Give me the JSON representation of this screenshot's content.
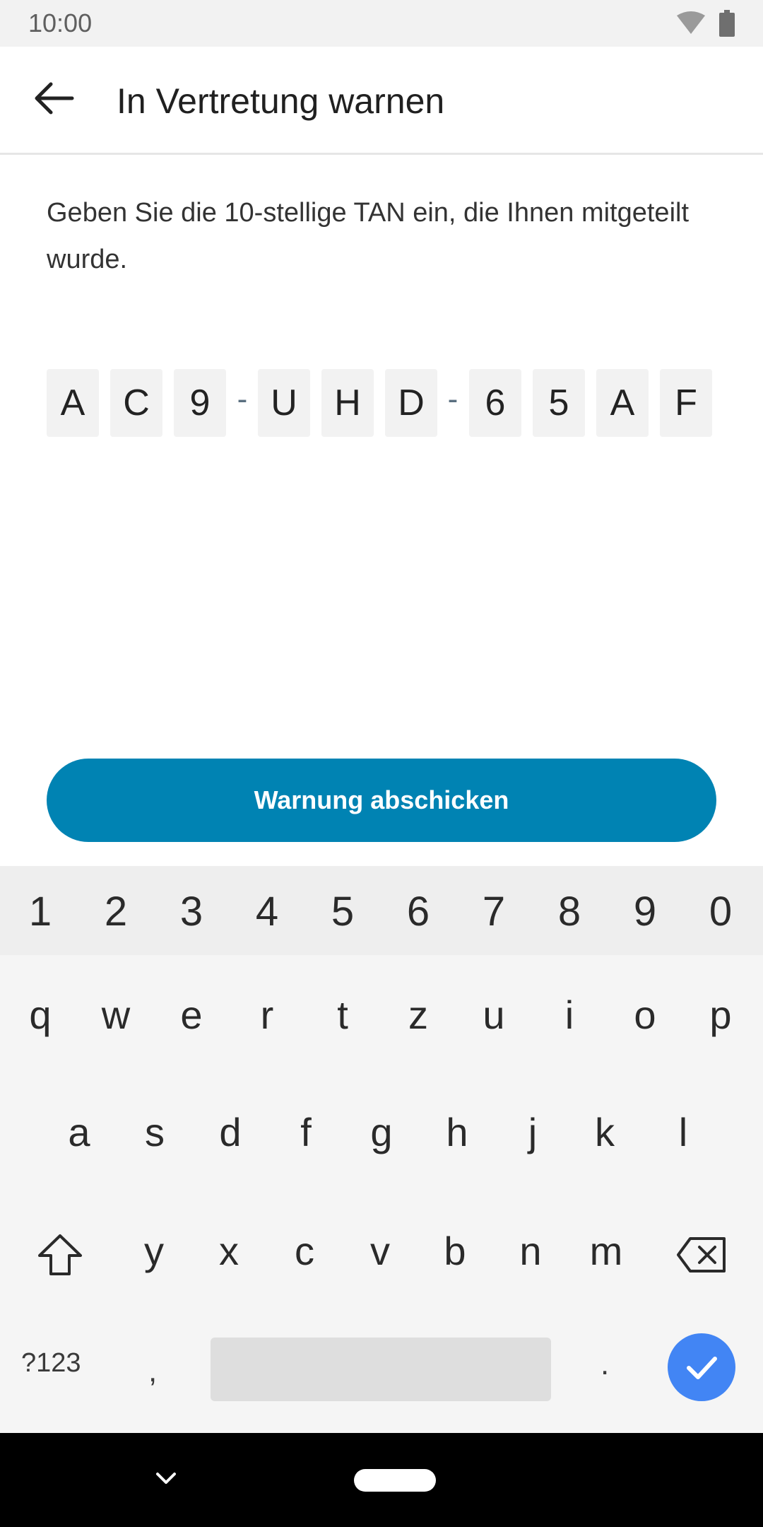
{
  "status_bar": {
    "time": "10:00",
    "icons": [
      "wifi-icon",
      "battery-icon"
    ]
  },
  "app_bar": {
    "back_icon": "arrow-left-icon",
    "title": "In Vertretung warnen"
  },
  "instruction": "Geben Sie die 10-stellige TAN ein, die Ihnen mitgeteilt wurde.",
  "tan": {
    "chars": [
      "A",
      "C",
      "9",
      "U",
      "H",
      "D",
      "6",
      "5",
      "A",
      "F"
    ],
    "separator": "-"
  },
  "submit_button": {
    "label": "Warnung abschicken"
  },
  "keyboard": {
    "number_row": [
      "1",
      "2",
      "3",
      "4",
      "5",
      "6",
      "7",
      "8",
      "9",
      "0"
    ],
    "row1": [
      "q",
      "w",
      "e",
      "r",
      "t",
      "z",
      "u",
      "i",
      "o",
      "p"
    ],
    "row2": [
      "a",
      "s",
      "d",
      "f",
      "g",
      "h",
      "j",
      "k",
      "l"
    ],
    "row3": [
      "y",
      "x",
      "c",
      "v",
      "b",
      "n",
      "m"
    ],
    "symbols_label": "?123",
    "comma": ",",
    "period": "."
  },
  "colors": {
    "accent": "#0083b3",
    "keyboard_enter": "#4285f4"
  }
}
